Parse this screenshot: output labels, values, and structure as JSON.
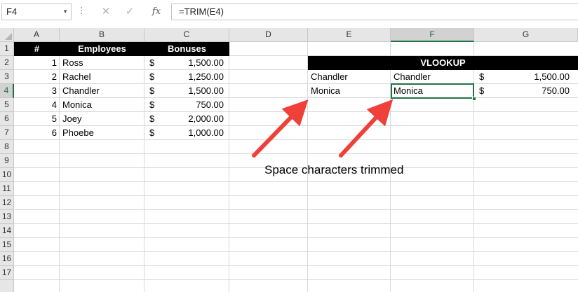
{
  "formula_bar": {
    "name_box": "F4",
    "cancel_icon": "✕",
    "enter_icon": "✓",
    "fx_label": "fx",
    "formula": "=TRIM(E4)"
  },
  "columns": [
    "A",
    "B",
    "C",
    "D",
    "E",
    "F",
    "G"
  ],
  "rows": [
    "1",
    "2",
    "3",
    "4",
    "5",
    "6",
    "7",
    "8",
    "9",
    "10",
    "11",
    "12",
    "13",
    "14",
    "15",
    "16",
    "17"
  ],
  "table1": {
    "headers": [
      "#",
      "Employees",
      "Bonuses"
    ],
    "rows": [
      {
        "num": "1",
        "name": "Ross",
        "currency": "$",
        "amount": "1,500.00"
      },
      {
        "num": "2",
        "name": "Rachel",
        "currency": "$",
        "amount": "1,250.00"
      },
      {
        "num": "3",
        "name": "Chandler",
        "currency": "$",
        "amount": "1,500.00"
      },
      {
        "num": "4",
        "name": "Monica",
        "currency": "$",
        "amount": "750.00"
      },
      {
        "num": "5",
        "name": "Joey",
        "currency": "$",
        "amount": "2,000.00"
      },
      {
        "num": "6",
        "name": "Phoebe",
        "currency": "$",
        "amount": "1,000.00"
      }
    ]
  },
  "vlookup": {
    "title": "VLOOKUP",
    "rows": [
      {
        "original": "Chandler",
        "trimmed": "Chandler",
        "currency": "$",
        "amount": "1,500.00"
      },
      {
        "original": "Monica",
        "trimmed": "Monica",
        "currency": "$",
        "amount": "750.00"
      }
    ]
  },
  "annotation": {
    "text": "Space characters trimmed",
    "arrow_color": "#f0403a"
  },
  "accent_color": "#217346",
  "active_cell": "F4"
}
